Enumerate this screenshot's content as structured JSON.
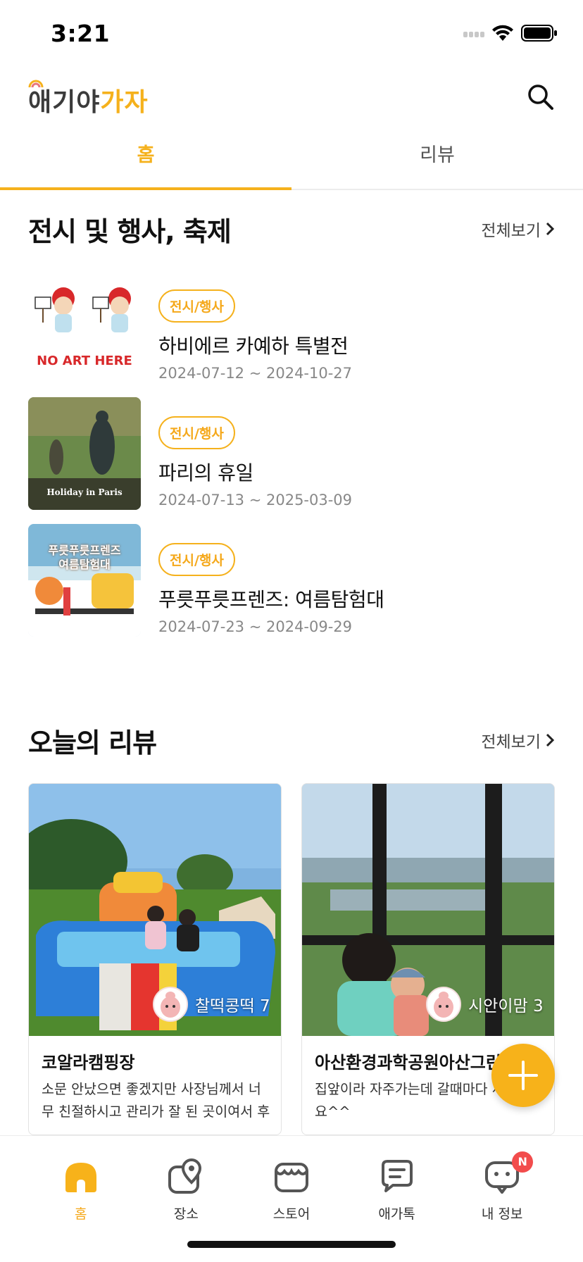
{
  "status_bar": {
    "time": "3:21"
  },
  "header": {
    "logo_part1": "애기야",
    "logo_part2": "가자",
    "search_icon": "search-icon"
  },
  "tabs": [
    {
      "label": "홈",
      "active": true
    },
    {
      "label": "리뷰",
      "active": false
    }
  ],
  "events_section": {
    "title": "전시 및 행사, 축제",
    "see_all": "전체보기",
    "items": [
      {
        "badge": "전시/행사",
        "title": "하비에르 카예하 특별전",
        "dates": "2024-07-12 ~ 2024-10-27",
        "thumb_text": "NO ART HERE"
      },
      {
        "badge": "전시/행사",
        "title": "파리의 휴일",
        "dates": "2024-07-13 ~ 2025-03-09",
        "thumb_text": "Holiday in Paris"
      },
      {
        "badge": "전시/행사",
        "title": "푸릇푸릇프렌즈: 여름탐험대",
        "dates": "2024-07-23 ~ 2024-09-29",
        "thumb_text": "푸릇푸릇프렌즈 여름탐험대"
      }
    ]
  },
  "reviews_section": {
    "title": "오늘의 리뷰",
    "see_all": "전체보기",
    "items": [
      {
        "username": "찰떡콩떡 7",
        "place": "코알라캠핑장",
        "text": "소문 안났으면 좋겠지만 사장님께서 너무 친절하시고 관리가 잘 된 곳이여서 후기…"
      },
      {
        "username": "시안이맘 3",
        "place": "아산환경과학공원아산그린",
        "text": "집앞이라 자주가는데 갈때마다 새 같아요^^"
      }
    ]
  },
  "bottom_nav": {
    "items": [
      {
        "label": "홈",
        "icon": "home-icon",
        "active": true
      },
      {
        "label": "장소",
        "icon": "map-pin-icon",
        "active": false
      },
      {
        "label": "스토어",
        "icon": "store-icon",
        "active": false
      },
      {
        "label": "애가톡",
        "icon": "chat-icon",
        "active": false
      },
      {
        "label": "내 정보",
        "icon": "profile-icon",
        "active": false,
        "badge": "N"
      }
    ]
  },
  "colors": {
    "accent": "#f5b11c",
    "badge_red": "#f24c4c"
  }
}
